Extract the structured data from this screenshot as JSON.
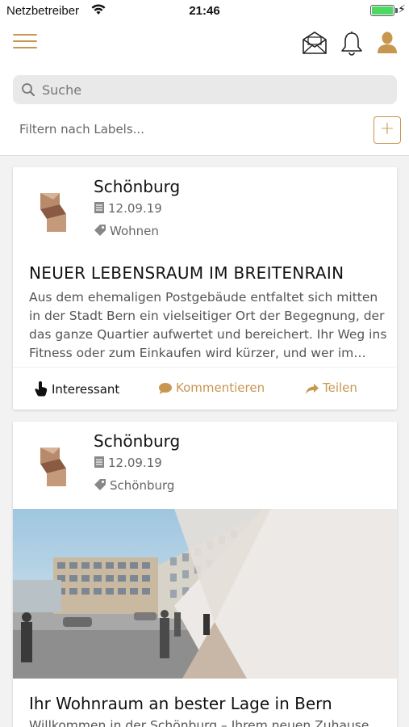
{
  "status_bar": {
    "carrier": "Netzbetreiber",
    "time": "21:46"
  },
  "search": {
    "placeholder": "Suche",
    "value": ""
  },
  "filter": {
    "placeholder": "Filtern nach Labels...",
    "add_label": "+"
  },
  "colors": {
    "accent": "#c8964f",
    "battery": "#4cd964"
  },
  "icons": {
    "menu": "hamburger-menu-icon",
    "mail": "envelope-icon",
    "notifications": "bell-icon",
    "profile": "user-icon",
    "date": "document-icon",
    "tag": "tag-icon",
    "like": "hand-pointer-icon",
    "comment": "speech-bubble-icon",
    "share": "share-arrow-icon"
  },
  "posts": [
    {
      "author": "Schönburg",
      "date": "12.09.19",
      "label": "Wohnen",
      "title": "NEUER LEBENSRAUM IM BREITENRAIN",
      "excerpt": "Aus dem ehemaligen Postgebäude entfaltet sich mitten in der Stadt Bern ein vielseitiger Ort der Begegnung, der das ganze Quartier aufwertet und bereichert. Ihr Weg ins Fitness oder zum Einkaufen wird kürzer, und wer im…",
      "actions": {
        "like": "Interessant",
        "comment": "Kommentieren",
        "share": "Teilen"
      }
    },
    {
      "author": "Schönburg",
      "date": "12.09.19",
      "label": "Schönburg",
      "title": "Ihr Wohnraum an bester Lage in Bern",
      "excerpt": "Willkommen in der Schönburg – Ihrem neuen Zuhause"
    }
  ]
}
